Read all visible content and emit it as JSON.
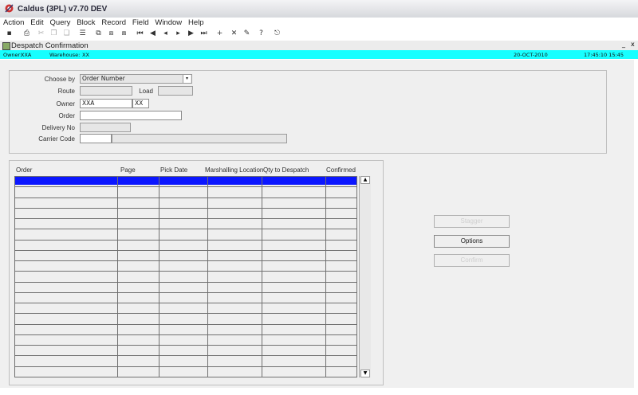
{
  "window": {
    "title": "Caldus (3PL) v7.70 DEV"
  },
  "menu": [
    "Action",
    "Edit",
    "Query",
    "Block",
    "Record",
    "Field",
    "Window",
    "Help"
  ],
  "toolbar_icons": [
    "save-icon",
    "print-icon",
    "cut-icon",
    "copy-icon",
    "paste-icon",
    "list-icon",
    "query-icon",
    "execute-icon",
    "cancel-query-icon",
    "first-record-icon",
    "prev-block-icon",
    "prev-record-icon",
    "next-record-icon",
    "next-block-icon",
    "last-record-icon",
    "insert-record-icon",
    "delete-record-icon",
    "edit-icon",
    "help-icon",
    "exit-icon"
  ],
  "form": {
    "title": "Despatch Confirmation"
  },
  "status": {
    "owner_label": "Owner:",
    "owner": "XXA",
    "warehouse_label": "Warehouse:",
    "warehouse": "XX",
    "date": "20-OCT-2010",
    "time": "17:45:10  15:45"
  },
  "criteria": {
    "choose_by_label": "Choose by",
    "choose_by_value": "Order Number",
    "route_label": "Route",
    "load_label": "Load",
    "owner_label": "Owner",
    "owner_value": "XXA",
    "owner_value2": "XX",
    "order_label": "Order",
    "delivery_no_label": "Delivery No",
    "carrier_code_label": "Carrier Code"
  },
  "table": {
    "columns": [
      "Order",
      "Page",
      "Pick Date",
      "Marshalling Location",
      "Qty to Despatch",
      "Confirmed"
    ],
    "row_count": 19
  },
  "buttons": {
    "first": "Stagger",
    "options": "Options",
    "confirm": "Confirm"
  }
}
